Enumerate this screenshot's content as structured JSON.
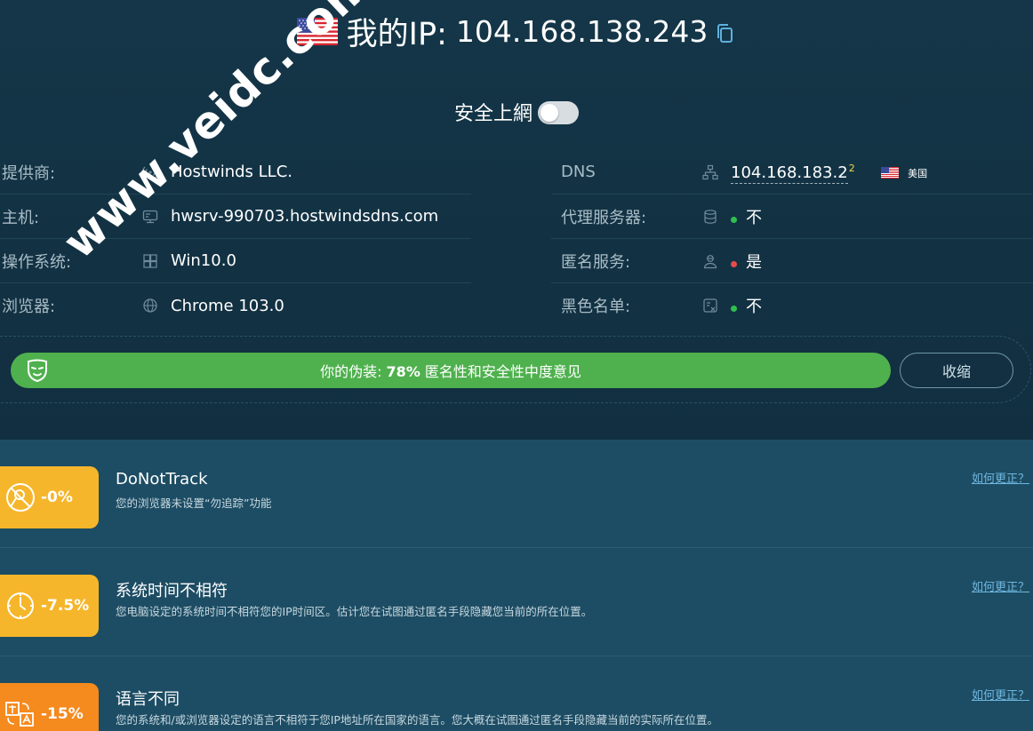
{
  "header": {
    "ip_prefix": "我的IP:",
    "ip": "104.168.138.243"
  },
  "secure": {
    "label": "安全上網",
    "enabled": false
  },
  "info_left": [
    {
      "label": "提供商:",
      "value": "Hostwinds LLC.",
      "icon": "signal-icon"
    },
    {
      "label": "主机:",
      "value": "hwsrv-990703.hostwindsdns.com",
      "icon": "server-icon"
    },
    {
      "label": "操作系统:",
      "value": "Win10.0",
      "icon": "windows-icon"
    },
    {
      "label": "浏览器:",
      "value": "Chrome 103.0",
      "icon": "globe-icon"
    }
  ],
  "info_right": {
    "dns": {
      "label": "DNS",
      "value": "104.168.183.2",
      "sup": "2",
      "country": "美国"
    },
    "proxy": {
      "label": "代理服务器:",
      "value": "不",
      "status": "#2fbf4f"
    },
    "anonymizer": {
      "label": "匿名服务:",
      "value": "是",
      "status": "#e94b4b"
    },
    "blacklist": {
      "label": "黑色名单:",
      "value": "不",
      "status": "#2fbf4f"
    }
  },
  "disguise": {
    "prefix": "你的伪装: ",
    "percent": "78%",
    "percent_value": 78,
    "suffix": " 匿名性和安全性中度意见",
    "collapse_label": "收缩"
  },
  "factors": [
    {
      "pct": "-0%",
      "title": "DoNotTrack",
      "desc": "您的浏览器未设置“勿追踪”功能",
      "link": "如何更正？",
      "color": "#f6b62b",
      "icon": "no-tracking-icon"
    },
    {
      "pct": "-7.5%",
      "title": "系统时间不相符",
      "desc": "您电脑设定的系统时间不相符您的IP时间区。估计您在试图通过匿名手段隐藏您当前的所在位置。",
      "link": "如何更正？",
      "color": "#f6b62b",
      "icon": "clock-icon"
    },
    {
      "pct": "-15%",
      "title": "语言不同",
      "desc": "您的系统和/或浏览器设定的语言不相符于您IP地址所在国家的语言。您大概在试图通过匿名手段隐藏当前的实际所在位置。",
      "link": "如何更正？",
      "color": "#f58a1f",
      "icon": "translate-icon"
    }
  ],
  "watermark": "www.veidc.com"
}
